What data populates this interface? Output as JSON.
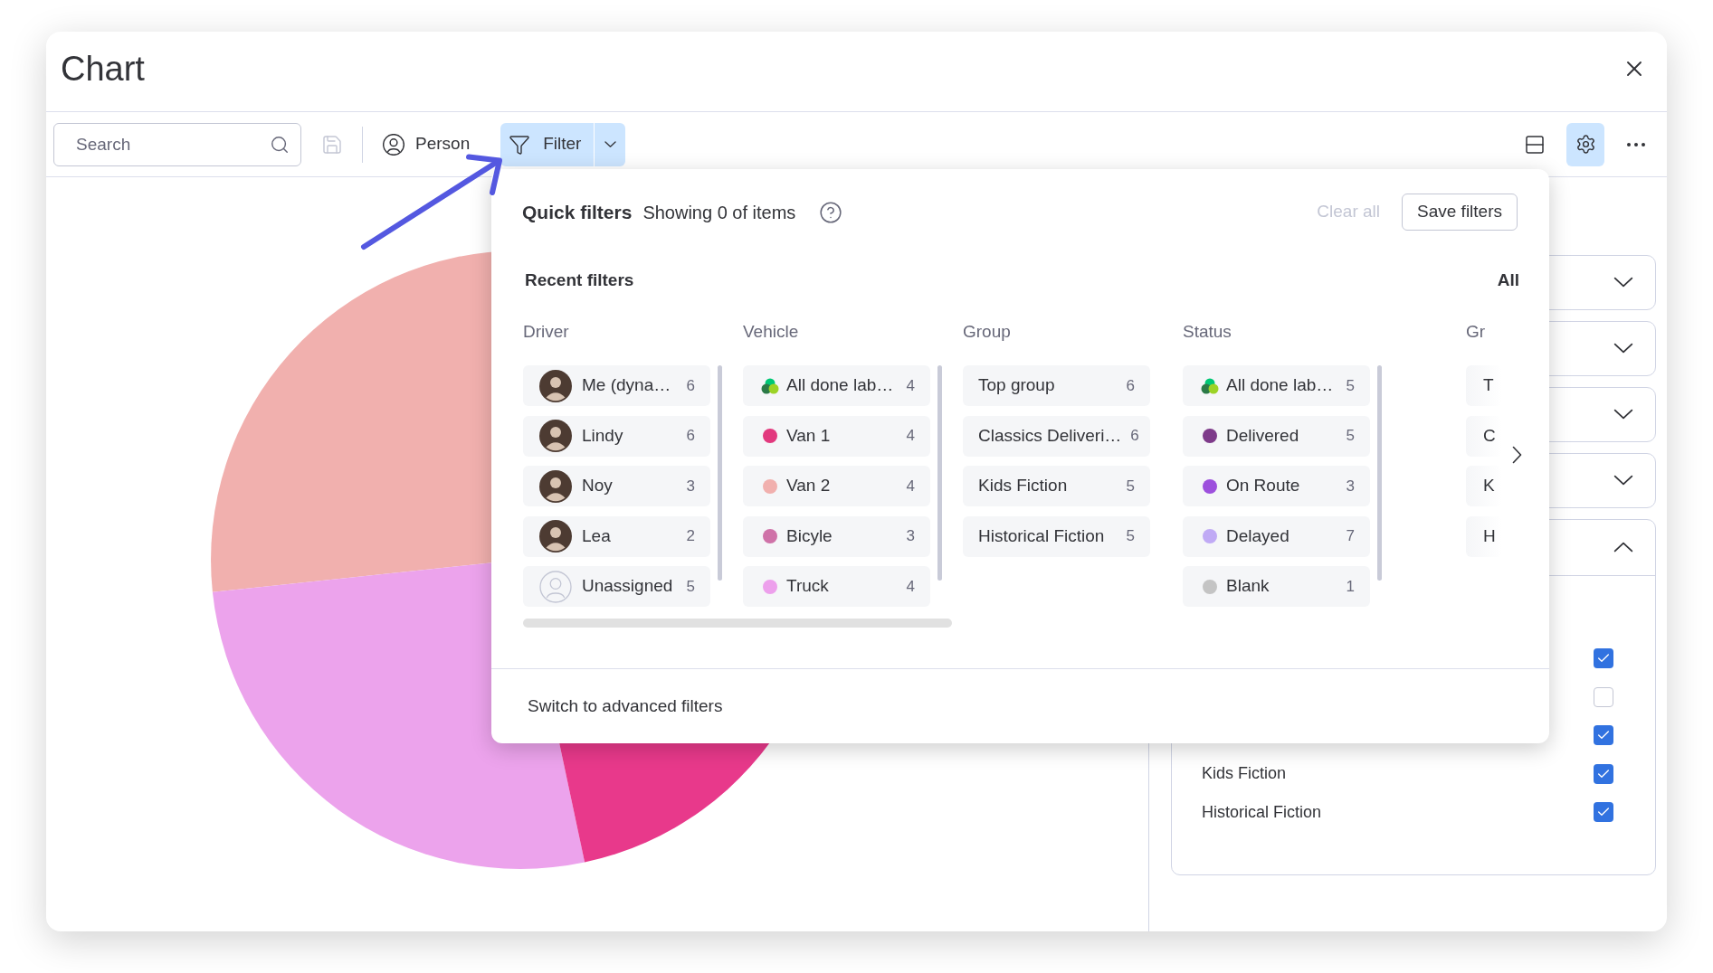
{
  "window": {
    "title": "Chart"
  },
  "toolbar": {
    "search": {
      "placeholder": "Search"
    },
    "save_button": {
      "disabled": true
    },
    "person_button": {
      "label": "Person"
    },
    "filter_button": {
      "label": "Filter",
      "selected": true
    },
    "view_buttons": [
      {
        "kind": "layout",
        "selected": false
      },
      {
        "kind": "settings",
        "selected": true
      },
      {
        "kind": "more",
        "selected": false
      }
    ]
  },
  "quick_filters": {
    "title": "Quick filters",
    "summary": "Showing 0 of items",
    "clear_all": {
      "label": "Clear all",
      "disabled": true
    },
    "save_button": {
      "label": "Save filters"
    },
    "recent_filters": {
      "title": "Recent filters",
      "all_label": "All"
    },
    "columns": [
      {
        "heading": "Driver",
        "items": [
          {
            "kind": "avatar",
            "label": "Me (dyna…",
            "count": "6",
            "selected": false
          },
          {
            "kind": "avatar",
            "label": "Lindy",
            "count": "6",
            "selected": false
          },
          {
            "kind": "avatar",
            "label": "Noy",
            "count": "3",
            "selected": false
          },
          {
            "kind": "avatar",
            "label": "Lea",
            "count": "2",
            "selected": false
          },
          {
            "kind": "unassigned",
            "label": "Unassigned",
            "count": "5",
            "selected": false
          }
        ]
      },
      {
        "heading": "Vehicle",
        "items": [
          {
            "kind": "all-done",
            "label": "All done lab…",
            "count": "4",
            "selected": false
          },
          {
            "kind": "dot",
            "label": "Van 1",
            "count": "4",
            "color": "#e2397e",
            "selected": false
          },
          {
            "kind": "dot",
            "label": "Van 2",
            "count": "4",
            "color": "#f1b0ae",
            "selected": false
          },
          {
            "kind": "dot",
            "label": "Bicyle",
            "count": "3",
            "color": "#cf72a8",
            "selected": false
          },
          {
            "kind": "dot",
            "label": "Truck",
            "count": "4",
            "color": "#eda0ec",
            "selected": false
          }
        ]
      },
      {
        "heading": "Group",
        "items": [
          {
            "kind": "text",
            "label": "Top group",
            "count": "6",
            "selected": false
          },
          {
            "kind": "text",
            "label": "Classics Deliveri…",
            "count": "6",
            "selected": false
          },
          {
            "kind": "text",
            "label": "Kids Fiction",
            "count": "5",
            "selected": false
          },
          {
            "kind": "text",
            "label": "Historical Fiction",
            "count": "5",
            "selected": false
          }
        ]
      },
      {
        "heading": "Status",
        "items": [
          {
            "kind": "all-done",
            "label": "All done lab…",
            "count": "5",
            "selected": false
          },
          {
            "kind": "dot",
            "label": "Delivered",
            "count": "5",
            "color": "#7e3b8a",
            "selected": false
          },
          {
            "kind": "dot",
            "label": "On Route",
            "count": "3",
            "color": "#9d50dd",
            "selected": false
          },
          {
            "kind": "dot",
            "label": "Delayed",
            "count": "7",
            "color": "#c0aaf5",
            "selected": false
          },
          {
            "kind": "dot",
            "label": "Blank",
            "count": "1",
            "color": "#c4c4c4",
            "selected": false
          }
        ]
      },
      {
        "heading": "Gr",
        "clipped": true,
        "items": [
          {
            "kind": "text",
            "label": "T",
            "selected": false
          },
          {
            "kind": "text",
            "label": "C",
            "selected": false
          },
          {
            "kind": "text",
            "label": "K",
            "selected": false
          },
          {
            "kind": "text",
            "label": "H",
            "selected": false
          }
        ]
      }
    ],
    "footer_link": "Switch to advanced filters"
  },
  "settings_panel": {
    "sections": [
      {
        "expanded": false
      },
      {
        "expanded": false
      },
      {
        "expanded": false
      },
      {
        "expanded": false
      },
      {
        "expanded": true,
        "options": [
          {
            "checked": true
          },
          {
            "checked": false
          },
          {
            "checked": true
          },
          {
            "label": "Kids Fiction",
            "checked": true
          },
          {
            "label": "Historical Fiction",
            "checked": true
          }
        ]
      }
    ]
  }
}
